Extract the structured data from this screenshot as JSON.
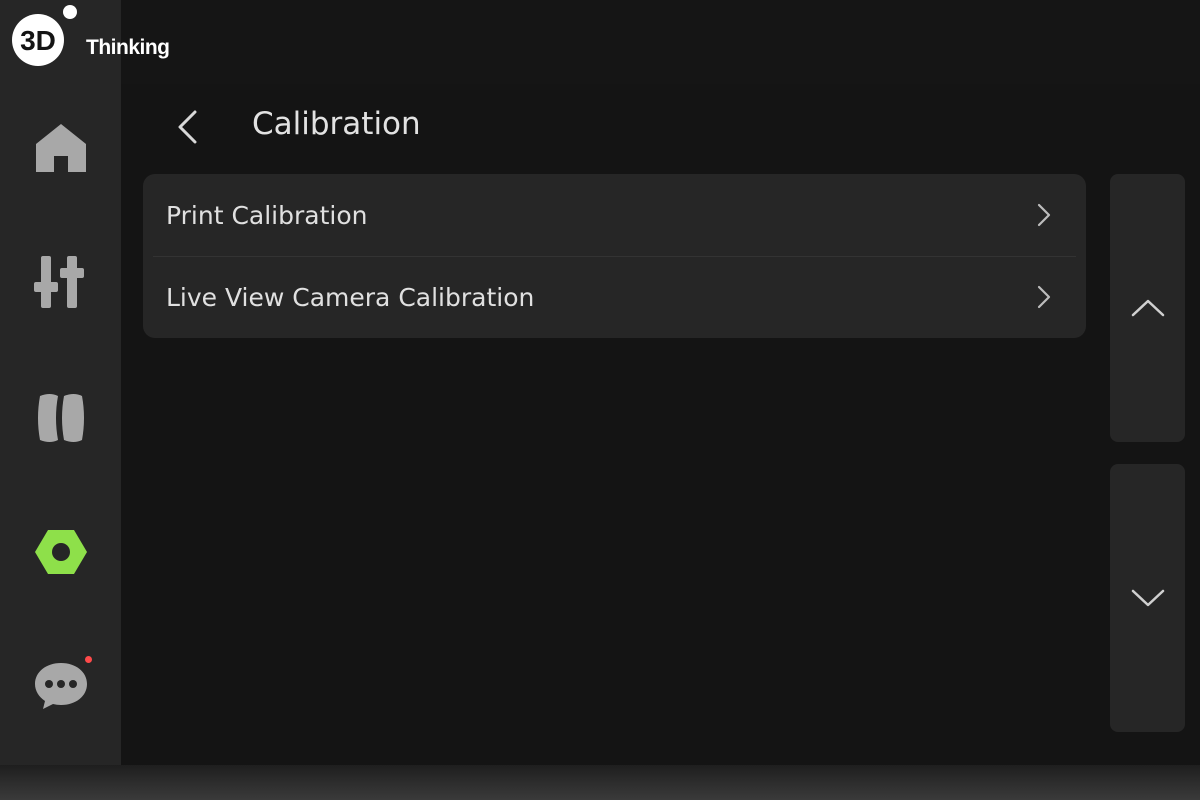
{
  "branding": {
    "logo_mark": "3D",
    "logo_text": "Thinking"
  },
  "sidebar": {
    "items": [
      {
        "id": "home",
        "icon": "home-icon",
        "active": false
      },
      {
        "id": "controls",
        "icon": "sliders-icon",
        "active": false
      },
      {
        "id": "filament",
        "icon": "filament-spool-icon",
        "active": false
      },
      {
        "id": "settings",
        "icon": "hex-nut-icon",
        "active": true
      },
      {
        "id": "messages",
        "icon": "chat-bubble-icon",
        "active": false,
        "has_notification": true
      }
    ],
    "colors": {
      "icon": "#a8a8a8",
      "active": "#8ee04a",
      "notification": "#ff4a4a"
    }
  },
  "header": {
    "back_icon": "chevron-left-icon",
    "title": "Calibration"
  },
  "menu": {
    "items": [
      {
        "label": "Print Calibration",
        "icon": "chevron-right-icon"
      },
      {
        "label": "Live View Camera Calibration",
        "icon": "chevron-right-icon"
      }
    ]
  },
  "scroll": {
    "up_icon": "chevron-up-icon",
    "down_icon": "chevron-down-icon"
  }
}
